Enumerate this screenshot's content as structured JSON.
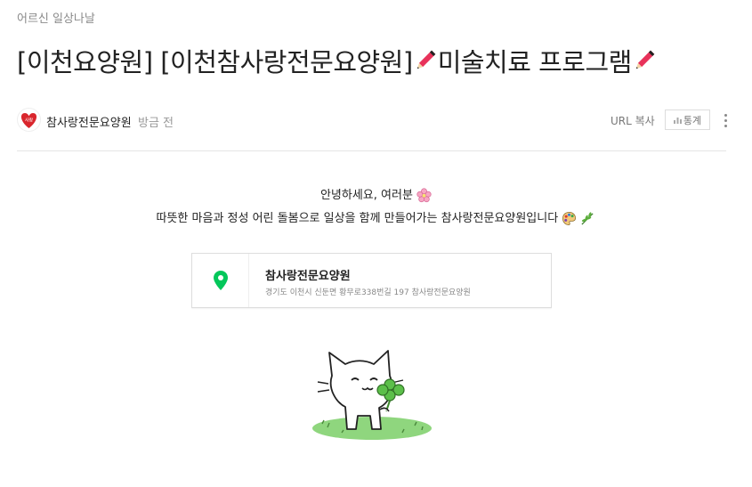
{
  "category": "어르신 일상나날",
  "post": {
    "title_part1": "[이천요양원] [이천참사랑전문요양원] ",
    "title_part2": "미술치료 프로그램",
    "pencil_icon": "pencil-icon"
  },
  "author": {
    "name": "참사랑전문요양원",
    "time": "방금 전",
    "avatar_text": "사랑"
  },
  "actions": {
    "url_copy": "URL 복사",
    "stats": "통계"
  },
  "content": {
    "greeting": "안녕하세요, 여러분",
    "intro": "따뜻한 마음과 정성 어린 돌봄으로 일상을 함께 만들어가는 참사랑전문요양원입니다"
  },
  "place": {
    "name": "참사랑전문요양원",
    "address": "경기도 이천시 신둔면 황무로338번길 197 참사랑전문요양원"
  },
  "colors": {
    "pin": "#03c75a",
    "pencil": "#e8325a",
    "avatar": "#d9262d"
  }
}
